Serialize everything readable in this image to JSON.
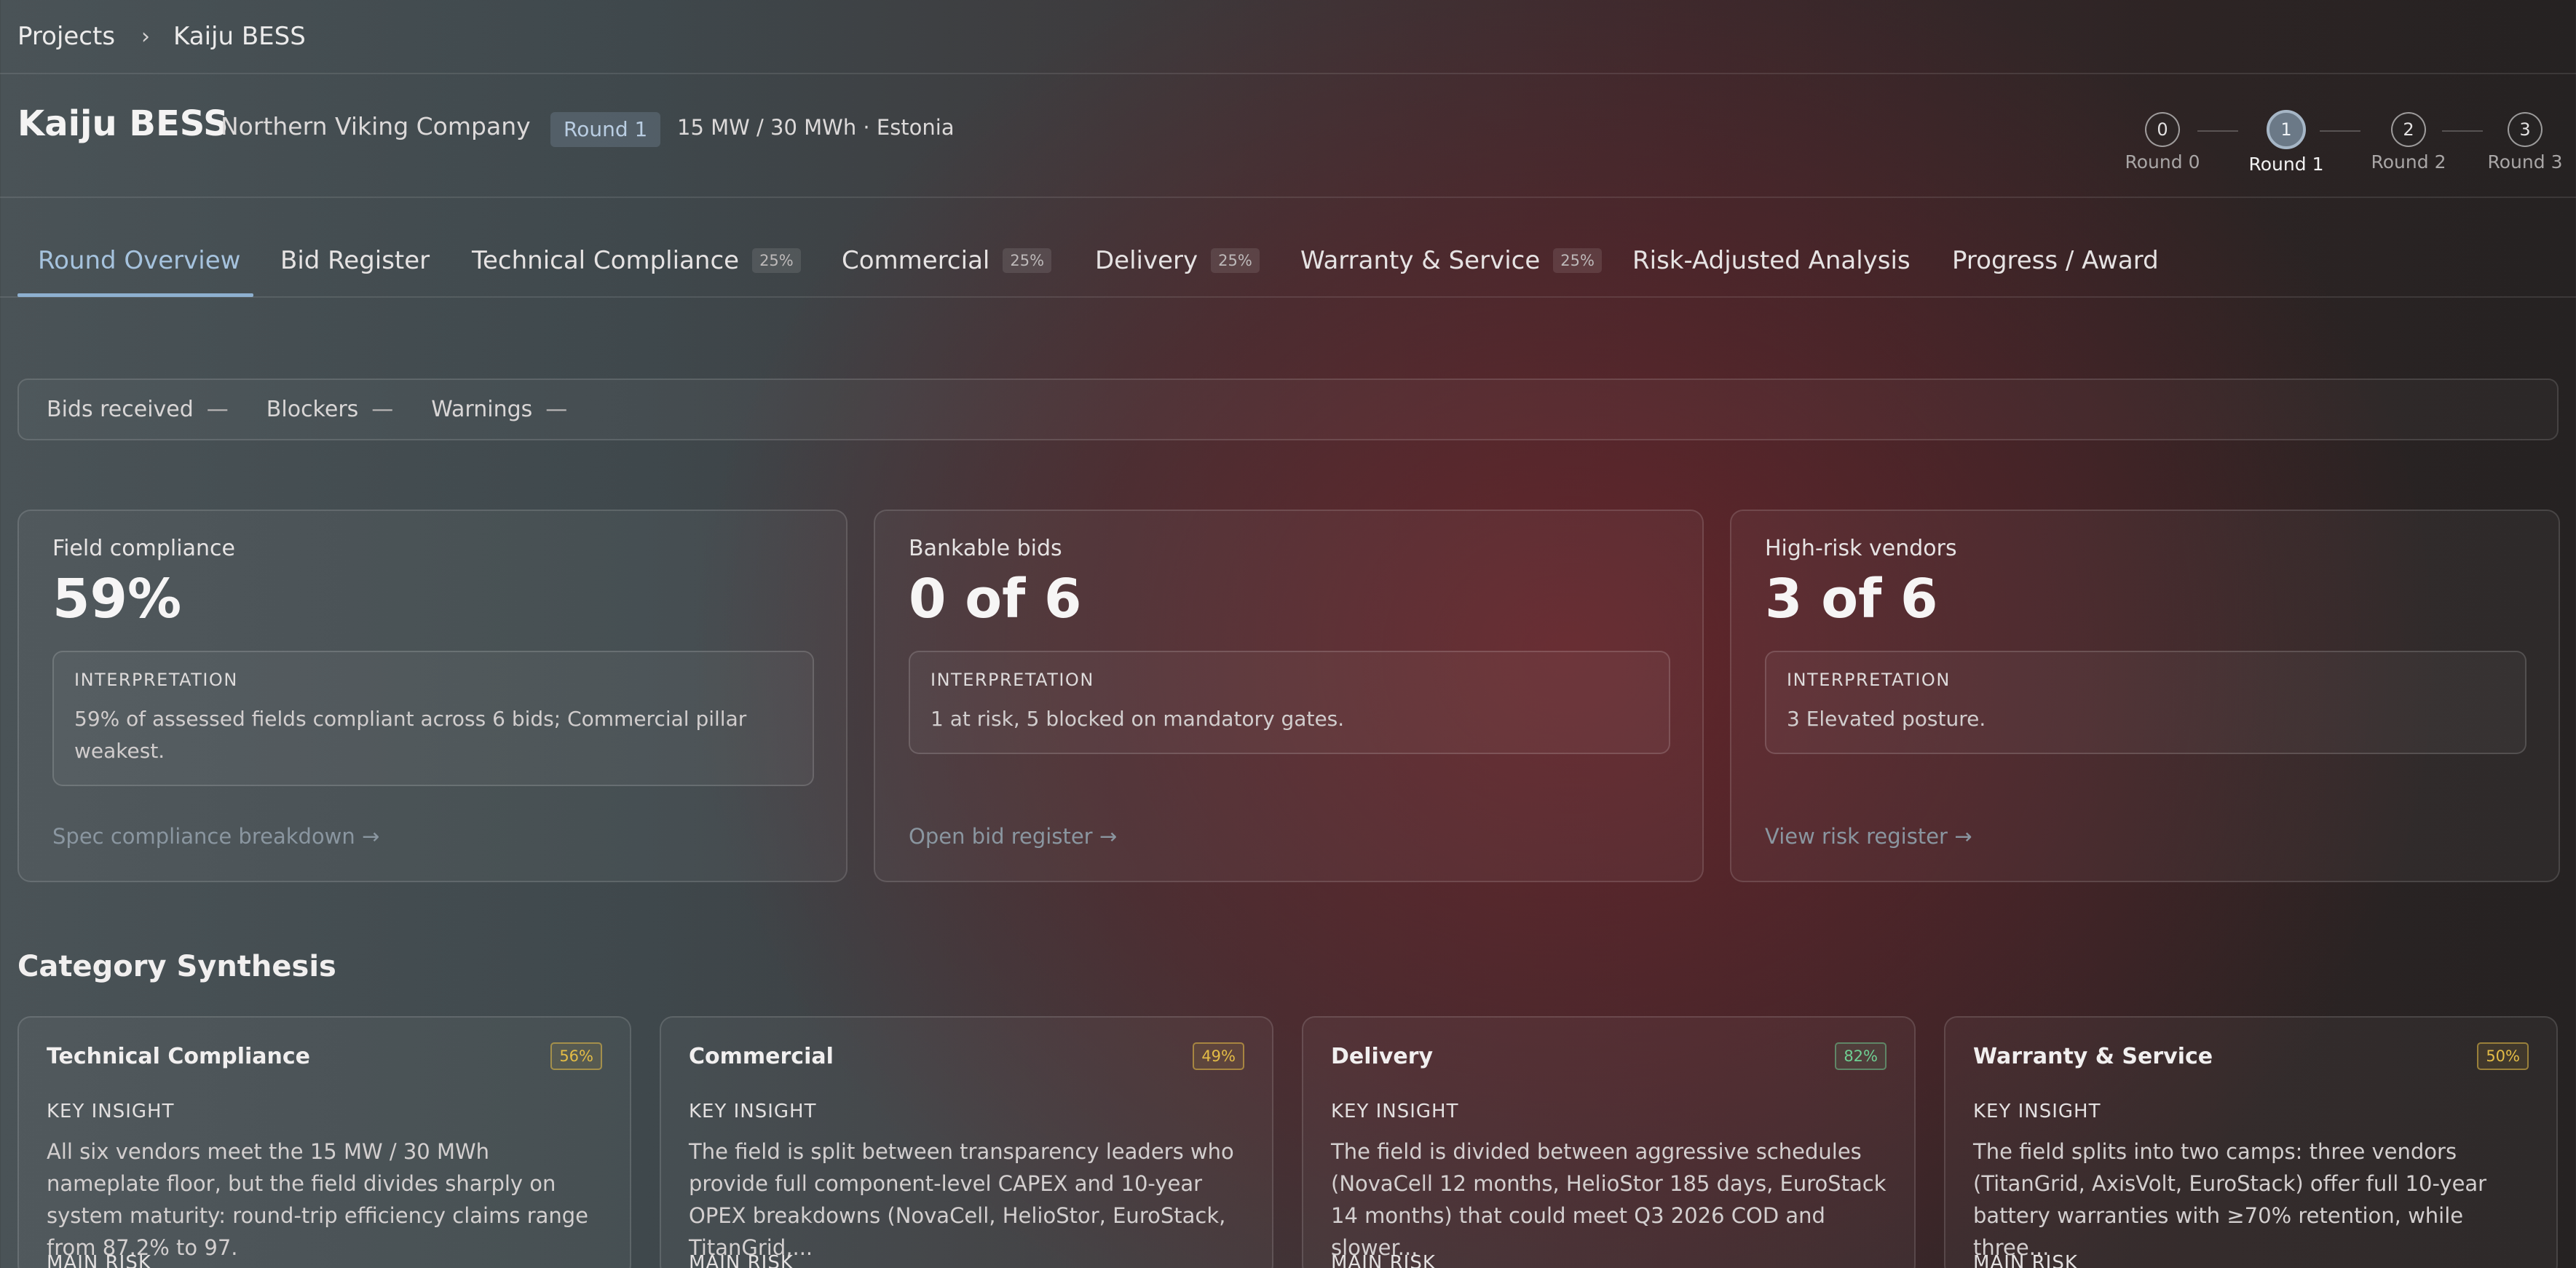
{
  "breadcrumb": {
    "root": "Projects",
    "separator": "›",
    "current": "Kaiju BESS"
  },
  "header": {
    "title": "Kaiju BESS",
    "company": "Northern Viking Company",
    "round_badge": "Round 1",
    "spec": "15 MW / 30 MWh · Estonia"
  },
  "stepper": {
    "steps": [
      {
        "num": "0",
        "label": "Round 0"
      },
      {
        "num": "1",
        "label": "Round 1"
      },
      {
        "num": "2",
        "label": "Round 2"
      },
      {
        "num": "3",
        "label": "Round 3"
      }
    ],
    "active_index": 1
  },
  "tabs": [
    {
      "label": "Round Overview",
      "pct": ""
    },
    {
      "label": "Bid Register",
      "pct": ""
    },
    {
      "label": "Technical Compliance",
      "pct": "25%"
    },
    {
      "label": "Commercial",
      "pct": "25%"
    },
    {
      "label": "Delivery",
      "pct": "25%"
    },
    {
      "label": "Warranty & Service",
      "pct": "25%"
    },
    {
      "label": "Risk-Adjusted Analysis",
      "pct": ""
    },
    {
      "label": "Progress / Award",
      "pct": ""
    }
  ],
  "summary": {
    "bids_label": "Bids received",
    "bids_value": "—",
    "blockers_label": "Blockers",
    "blockers_value": "—",
    "warnings_label": "Warnings",
    "warnings_value": "—"
  },
  "kpis": [
    {
      "label": "Field compliance",
      "value": "59%",
      "interp_title": "INTERPRETATION",
      "interp_body": "59% of assessed fields compliant across 6 bids; Commercial pillar weakest.",
      "link": "Spec compliance breakdown →"
    },
    {
      "label": "Bankable bids",
      "value": "0 of 6",
      "interp_title": "INTERPRETATION",
      "interp_body": "1 at risk, 5 blocked on mandatory gates.",
      "link": "Open bid register →"
    },
    {
      "label": "High-risk vendors",
      "value": "3 of 6",
      "interp_title": "INTERPRETATION",
      "interp_body": "3 Elevated posture.",
      "link": "View risk register →"
    }
  ],
  "synthesis": {
    "title": "Category Synthesis",
    "cards": [
      {
        "title": "Technical Compliance",
        "badge": "56%",
        "badge_color": "#e3bc46",
        "key_label": "KEY INSIGHT",
        "insight": "All six vendors meet the 15 MW / 30 MWh nameplate floor, but the field divides sharply on system maturity: round-trip efficiency claims range from 87.2% to 97.",
        "risk_label": "MAIN RISK"
      },
      {
        "title": "Commercial",
        "badge": "49%",
        "badge_color": "#e3bc46",
        "key_label": "KEY INSIGHT",
        "insight": "The field is split between transparency leaders who provide full component-level CAPEX and 10-year OPEX breakdowns (NovaCell, HelioStor, EuroStack, TitanGrid,...",
        "risk_label": "MAIN RISK"
      },
      {
        "title": "Delivery",
        "badge": "82%",
        "badge_color": "#6fd093",
        "key_label": "KEY INSIGHT",
        "insight": "The field is divided between aggressive schedules (NovaCell 12 months, HelioStor 185 days, EuroStack 14 months) that could meet Q3 2026 COD and slower...",
        "risk_label": "MAIN RISK"
      },
      {
        "title": "Warranty & Service",
        "badge": "50%",
        "badge_color": "#e3bc46",
        "key_label": "KEY INSIGHT",
        "insight": "The field splits into two camps: three vendors (TitanGrid, AxisVolt, EuroStack) offer full 10-year battery warranties with ≥70% retention, while three...",
        "risk_label": "MAIN RISK"
      }
    ]
  }
}
